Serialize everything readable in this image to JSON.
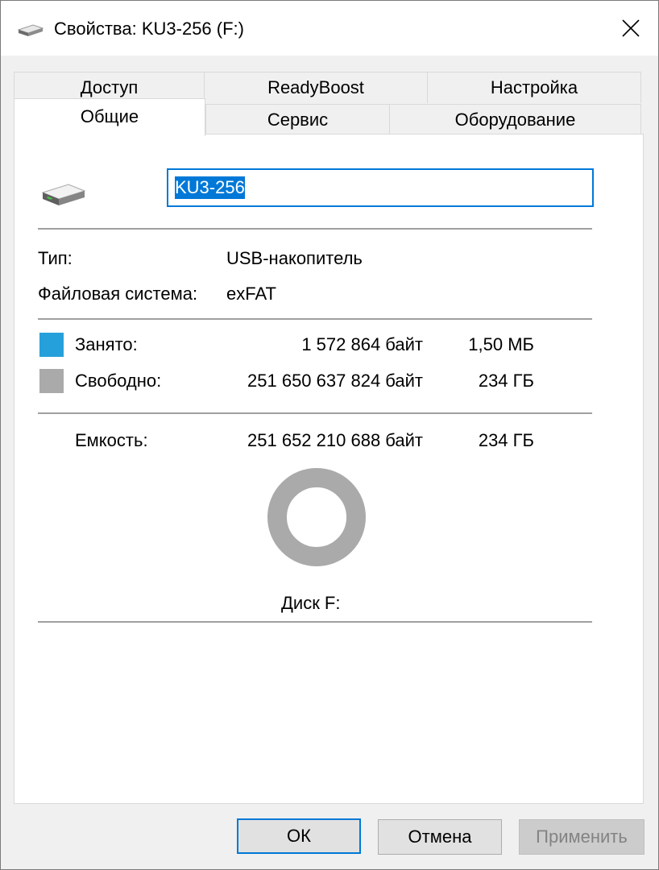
{
  "window": {
    "title": "Свойства: KU3-256 (F:)"
  },
  "tabs": {
    "row_top": [
      "Доступ",
      "ReadyBoost",
      "Настройка"
    ],
    "row_bottom": [
      "Общие",
      "Сервис",
      "Оборудование"
    ],
    "active": "Общие"
  },
  "general": {
    "volume_name": "KU3-256",
    "type_label": "Тип:",
    "type_value": "USB-накопитель",
    "fs_label": "Файловая система:",
    "fs_value": "exFAT",
    "used_label": "Занято:",
    "used_bytes": "1 572 864 байт",
    "used_size": "1,50 МБ",
    "used_color": "#26a0da",
    "free_label": "Свободно:",
    "free_bytes": "251 650 637 824 байт",
    "free_size": "234 ГБ",
    "free_color": "#aaaaaa",
    "capacity_label": "Емкость:",
    "capacity_bytes": "251 652 210 688 байт",
    "capacity_size": "234 ГБ",
    "disk_label": "Диск F:",
    "used_fraction": 6.25e-06
  },
  "buttons": {
    "ok": "ОК",
    "cancel": "Отмена",
    "apply": "Применить"
  },
  "icons": {
    "title": "usb-drive-icon",
    "close": "close-icon",
    "drive": "usb-drive-icon"
  }
}
